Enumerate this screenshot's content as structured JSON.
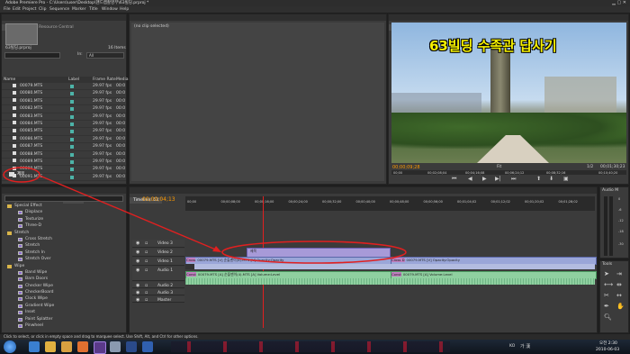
{
  "window": {
    "title": "Adobe Premiere Pro - C:\\Users\\user\\Desktop\\핸드캠촬영부\\63빌딩.prproj *"
  },
  "menu": [
    "File",
    "Edit",
    "Project",
    "Clip",
    "Sequence",
    "Marker",
    "Title",
    "Window",
    "Help"
  ],
  "project_panel": {
    "tabs": [
      "Project: 64",
      "Resource Central"
    ],
    "file_name": "63빌딩.prproj",
    "item_count": "16 Items",
    "in_label": "In:",
    "in_value": "All",
    "columns": [
      "Name",
      "Label",
      "Frame Rate",
      "Media"
    ],
    "items": [
      {
        "name": "00079.MTS",
        "rate": "29.97 fps",
        "media": "00:0"
      },
      {
        "name": "00080.MTS",
        "rate": "29.97 fps",
        "media": "00:0"
      },
      {
        "name": "00081.MTS",
        "rate": "29.97 fps",
        "media": "00:0"
      },
      {
        "name": "00082.MTS",
        "rate": "29.97 fps",
        "media": "00:0"
      },
      {
        "name": "00083.MTS",
        "rate": "29.97 fps",
        "media": "00:0"
      },
      {
        "name": "00084.MTS",
        "rate": "29.97 fps",
        "media": "00:0"
      },
      {
        "name": "00085.MTS",
        "rate": "29.97 fps",
        "media": "00:0"
      },
      {
        "name": "00086.MTS",
        "rate": "29.97 fps",
        "media": "00:0"
      },
      {
        "name": "00087.MTS",
        "rate": "29.97 fps",
        "media": "00:0"
      },
      {
        "name": "00088.MTS",
        "rate": "29.97 fps",
        "media": "00:0"
      },
      {
        "name": "00089.MTS",
        "rate": "29.97 fps",
        "media": "00:0"
      },
      {
        "name": "00090.MTS",
        "rate": "29.97 fps",
        "media": "00:0"
      },
      {
        "name": "00091.MTS",
        "rate": "29.97 fps",
        "media": "00:0"
      }
    ],
    "sequence_item": "제목"
  },
  "effect_controls": {
    "tabs": [
      "Source: (no clips)",
      "Effect Controls",
      "Audio Mixer: 63",
      "Metadata"
    ],
    "message": "(no clip selected)"
  },
  "program_monitor": {
    "tab": "Program: 63",
    "title_overlay": "63빌딩 수족관 답사기",
    "timecode": "00;00;09;28",
    "duration": "00;01;30;23",
    "ruler": [
      "00;00",
      "00;02;08;04",
      "00;04;16;08",
      "00;06;24;12",
      "00;08;32;16",
      "00;10;40;20"
    ],
    "zoom": "Fit",
    "fraction": "1/2"
  },
  "effects_panel": {
    "tabs": [
      "Media Browser",
      "Info",
      "Effects",
      "History"
    ],
    "items": [
      {
        "label": "Special Effect",
        "level": 1
      },
      {
        "label": "Displace",
        "level": 2
      },
      {
        "label": "Texturize",
        "level": 2
      },
      {
        "label": "Three-D",
        "level": 2
      },
      {
        "label": "Stretch",
        "level": 1
      },
      {
        "label": "Cross Stretch",
        "level": 2
      },
      {
        "label": "Stretch",
        "level": 2
      },
      {
        "label": "Stretch In",
        "level": 2
      },
      {
        "label": "Stretch Over",
        "level": 2
      },
      {
        "label": "Wipe",
        "level": 1
      },
      {
        "label": "Band Wipe",
        "level": 2
      },
      {
        "label": "Barn Doors",
        "level": 2
      },
      {
        "label": "Checker Wipe",
        "level": 2
      },
      {
        "label": "CheckerBoard",
        "level": 2
      },
      {
        "label": "Clock Wipe",
        "level": 2
      },
      {
        "label": "Gradient Wipe",
        "level": 2
      },
      {
        "label": "Inset",
        "level": 2
      },
      {
        "label": "Paint Splatter",
        "level": 2
      },
      {
        "label": "Pinwheel",
        "level": 2
      }
    ]
  },
  "timeline": {
    "tab": "Timeline: 63",
    "timecode": "00;00;04;13",
    "ruler": [
      "00;00",
      "00;00;08;00",
      "00;00;16;00",
      "00;00;24;00",
      "00;00;32;00",
      "00;00;40;00",
      "00;00;48;00",
      "00;00;56;00",
      "00;01;04;02",
      "00;01;12;02",
      "00;01;20;02",
      "00;01;28;02"
    ],
    "tracks": [
      "Video 3",
      "Video 2",
      "Video 1",
      "Audio 1",
      "Audio 2",
      "Audio 3",
      "Master"
    ],
    "title_clip": "제목",
    "video1_clip_a": "00079.MTS [V] 순돌맨이(4).MTS [V]  Opacity:Opacity",
    "video1_clip_b": "00079.MTS [V]  Opacity:Opacity",
    "video1_clip_b_prefix": "Cross D",
    "audio1_clip_a": "00079.MTS [A] 순돌맨이(4).MTS [A]  Volume:Level",
    "audio1_clip_b": "00079.MTS [A]  Volume:Level",
    "audio1_clip_b_prefix": "Const",
    "video1_clip_a_prefix": "Cross",
    "audio1_clip_a_prefix": "Const"
  },
  "audio_panel": {
    "tab": "Audio M",
    "db": [
      "0",
      "-6",
      "-12",
      "-18",
      "-30"
    ]
  },
  "tools_panel": {
    "tab": "Tools"
  },
  "status_bar": {
    "text": "Click to select, or click in empty space and drag to marquee select. Use Shift, Alt, and Ctrl for other options."
  },
  "taskbar": {
    "lang": "KO",
    "ime": "가 漢",
    "time": "오전 2:30",
    "date": "2010-06-03"
  },
  "colors": {
    "annotation": "#e02020",
    "accent": "#ff9a00",
    "clip_video": "#9aa6d8",
    "clip_audio": "#8fd0a0",
    "title_clip": "#a79ad8"
  }
}
